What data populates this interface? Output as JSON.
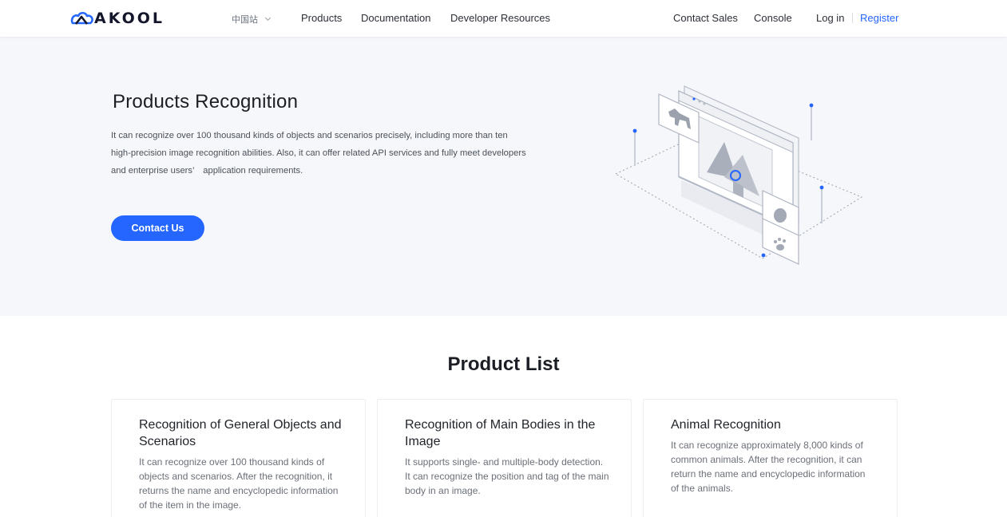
{
  "nav": {
    "brand": "AKOOL",
    "region": "中国站",
    "links": [
      "Products",
      "Documentation",
      "Developer Resources"
    ],
    "right_links": [
      "Contact Sales",
      "Console"
    ],
    "login": "Log in",
    "register": "Register"
  },
  "hero": {
    "title": "Products Recognition",
    "description": "It can recognize over 100 thousand kinds of objects and scenarios precisely, including more than ten high-precision image recognition abilities. Also, it can offer related API services and fully meet developers and enterprise users’　application requirements.",
    "button": "Contact Us"
  },
  "product_list": {
    "title": "Product List",
    "cards": [
      {
        "title": "Recognition of General Objects and Scenarios",
        "description": "It can recognize over 100 thousand kinds of objects and scenarios. After the recognition, it returns the name and encyclopedic information of the item in the image."
      },
      {
        "title": "Recognition of Main Bodies in the Image",
        "description": "It supports single- and multiple-body detection. It can recognize the position and tag of the main body in an image."
      },
      {
        "title": "Animal Recognition",
        "description": "It can recognize approximately 8,000 kinds of common animals. After the recognition, it can return the name and encyclopedic information of the animals."
      }
    ]
  },
  "colors": {
    "accent": "#2466ff",
    "hero_background": "#f6f7fa",
    "text_primary": "#1b1e24",
    "text_secondary": "#6b7078"
  },
  "icons": [
    "akool-logo-icon",
    "chevron-down-icon",
    "image-recognition-illustration"
  ]
}
